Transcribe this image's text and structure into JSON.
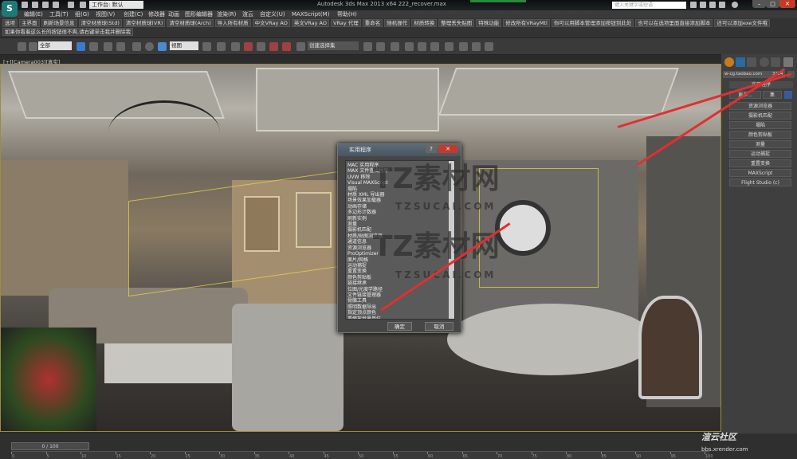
{
  "titlebar": {
    "app_title": "Autodesk 3ds Max 2013 x64  222_recover.max",
    "workspace": "工作台: 默认",
    "search_placeholder": "键入关键字或短语",
    "logo": "S",
    "win_min": "–",
    "win_max": "□",
    "win_close": "✕"
  },
  "menu": [
    "编辑(E)",
    "工具(T)",
    "组(G)",
    "视图(V)",
    "创建(C)",
    "修改器",
    "动画",
    "图形编辑器",
    "渲染(R)",
    "渲云",
    "自定义(U)",
    "MAXScript(M)",
    "帮助(H)"
  ],
  "custom_row1": [
    "选项",
    "主界面",
    "刷新场景信息",
    "清空材质球(Std)",
    "清空材质球(VR)",
    "清空材质球(Arch)",
    "导入所有材质",
    "中文VRay AO",
    "英文VRay AO",
    "VRay 代理",
    "重命名",
    "随机操作",
    "材质转换",
    "整理丢失贴图",
    "特殊功能",
    "修改所有VRayMtl",
    "你可以用脚本管理添加按钮到此处",
    "也可以在选项里面直接添加脚本",
    "还可以添加exe文件哦"
  ],
  "custom_row2": "如果你看着这么长的按钮很不爽,请右键单击我并删除我",
  "toolbar": {
    "filter": "全部",
    "ref_coord": "视图",
    "selection_set": "创建选择集"
  },
  "viewport": {
    "label": "[+][Camera003][真实]"
  },
  "watermark": {
    "big": "TZ素材网",
    "small": "TZSUCAI.COM"
  },
  "dialog": {
    "title": "实用程序",
    "help": "?",
    "close": "✕",
    "ok": "确定",
    "cancel": "取消",
    "items": [
      "MAC 实用程序",
      "MAX 文件查找程序",
      "UVW 移除",
      "Visual MAXScript",
      "塌陷",
      "材质 XML 导出器",
      "场景效果加载器",
      "动画存储",
      "多边形计数器",
      "刷新实例",
      "测量",
      "摄影机匹配",
      "材质/贴图浏览器",
      "通道信息",
      "资源浏览器",
      "ProOptimizer",
      "面片/网格",
      "运动捕捉",
      "重置变换",
      "颜色剪贴板",
      "链接继承",
      "位图/光度学路径",
      "文件链接管理器",
      "骨骼工具",
      "照明数据导出",
      "指定顶点颜色",
      "重缩放世界单位",
      "资源收集器"
    ]
  },
  "command_panel": {
    "field_value": "w-cg.taobao.com",
    "field_count": "3?24",
    "rollout": "实用程序",
    "more": "更多...",
    "sets": "集",
    "buttons": [
      "资源浏览器",
      "摄影机匹配",
      "塌陷",
      "颜色剪贴板",
      "测量",
      "运动捕捉",
      "重置变换",
      "MAXScript",
      "Flight Studio (c)"
    ]
  },
  "timeline": {
    "frame": "0 / 100",
    "ticks": [
      "0",
      "5",
      "10",
      "15",
      "20",
      "25",
      "30",
      "35",
      "40",
      "45",
      "50",
      "55",
      "60",
      "65",
      "70",
      "75",
      "80",
      "85",
      "90",
      "95",
      "100"
    ]
  },
  "brand": {
    "name": "渲云社区",
    "url": "bbs.xrender.com"
  }
}
